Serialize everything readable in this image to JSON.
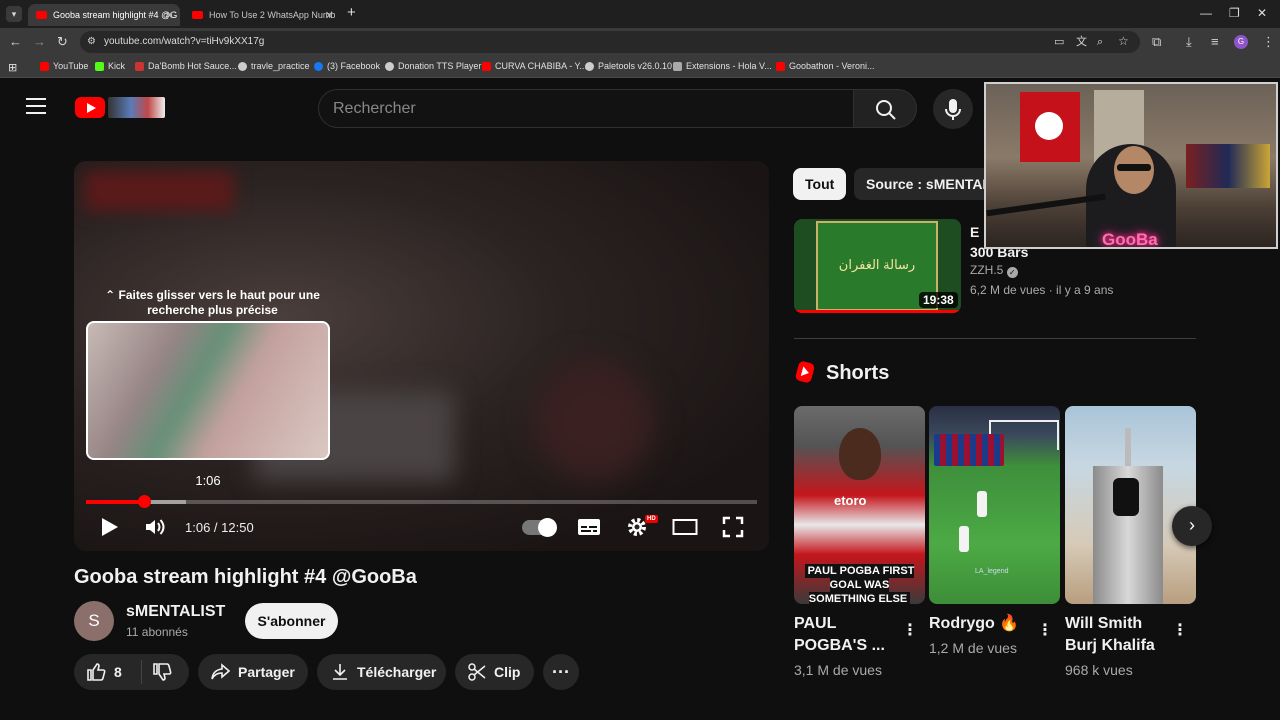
{
  "browser": {
    "tabs": [
      {
        "title": "Gooba stream highlight #4 @G",
        "active": true
      },
      {
        "title": "How To Use 2 WhatsApp Numb",
        "active": false
      }
    ],
    "new_tab": "+",
    "url": "youtube.com/watch?v=tiHv9kXX17g",
    "bookmarks": [
      {
        "label": "YouTube",
        "color": "#ff0000"
      },
      {
        "label": "Kick",
        "color": "#53fc18"
      },
      {
        "label": "Da'Bomb Hot Sauce...",
        "color": "#cc3333"
      },
      {
        "label": "travle_practice",
        "color": "#cccccc"
      },
      {
        "label": "(3) Facebook",
        "color": "#1877f2"
      },
      {
        "label": "Donation TTS Player",
        "color": "#cccccc"
      },
      {
        "label": "CURVA CHABIBA - Y...",
        "color": "#ff0000"
      },
      {
        "label": "Paletools v26.0.10",
        "color": "#cccccc"
      },
      {
        "label": "Extensions - Hola V...",
        "color": "#aaaaaa"
      },
      {
        "label": "Goobathon - Veroni...",
        "color": "#ff0000"
      }
    ]
  },
  "header": {
    "search_placeholder": "Rechercher"
  },
  "player": {
    "seek_hint": "⌃ Faites glisser vers le haut pour une recherche plus précise",
    "preview_time": "1:06",
    "current_time": "1:06",
    "duration": "12:50",
    "time_display": "1:06 / 12:50",
    "progress_fraction": 0.086,
    "buffer_fraction": 0.149,
    "hd_badge": "HD"
  },
  "video": {
    "title": "Gooba stream highlight #4 @GooBa",
    "channel": {
      "initial": "S",
      "name": "sMENTALIST",
      "subscribers": "11 abonnés"
    },
    "subscribe_label": "S'abonner",
    "likes": "8",
    "share_label": "Partager",
    "download_label": "Télécharger",
    "clip_label": "Clip",
    "more_label": "···"
  },
  "sidebar": {
    "chips": [
      "Tout",
      "Source : sMENTAL"
    ],
    "recommended": {
      "title": "E\n300 Bars",
      "channel": "ZZH.5",
      "meta": "6,2 M de vues · il y a 9 ans",
      "duration": "19:38",
      "thumb_text": "رسالة الغفران"
    },
    "shorts_heading": "Shorts",
    "shorts": [
      {
        "title": "PAUL POGBA'S ...",
        "views": "3,1 M de vues",
        "caption": "PAUL POGBA FIRST GOAL WAS SOMETHING ELSE",
        "brand": "etoro"
      },
      {
        "title": "Rodrygo 🔥",
        "views": "1,2 M de vues",
        "watermark": "LA_legend"
      },
      {
        "title": "Will Smith Burj Khalifa",
        "views": "968 k vues"
      }
    ]
  },
  "overlay": {
    "neon_text": "GooBa"
  }
}
